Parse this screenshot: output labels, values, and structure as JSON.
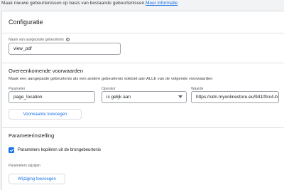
{
  "intro": {
    "text": "Maak nieuwe gebeurtenissen op basis van bestaande gebeurtenissen.",
    "link": "Meer informatie"
  },
  "configuratie": {
    "title": "Configuratie",
    "event_name_label": "Naam van aangepaste gebeurtenis",
    "event_name_value": "view_pdf"
  },
  "conditions": {
    "heading": "Overeenkomende voorwaarden",
    "description": "Maak een aangepaste gebeurtenis als een andere gebeurtenis voldoet aan ALLE van de volgende voorwaarden",
    "parameter_label": "Parameter",
    "parameter_value": "page_location",
    "operator_label": "Operator",
    "operator_value": "is gelijk aan",
    "value_label": "Waarde",
    "value_value": "https://cdn.myonlinestore.eu/9410fcc4-b",
    "add_button": "Voorwaarde toevoegen"
  },
  "params": {
    "heading": "Parameterinstelling",
    "copy_label": "Parameters kopiëren uit de brongebeurtenis",
    "copy_checked": true,
    "modify_label": "Parameters wijzigen",
    "add_button": "Wijziging toevoegen"
  }
}
